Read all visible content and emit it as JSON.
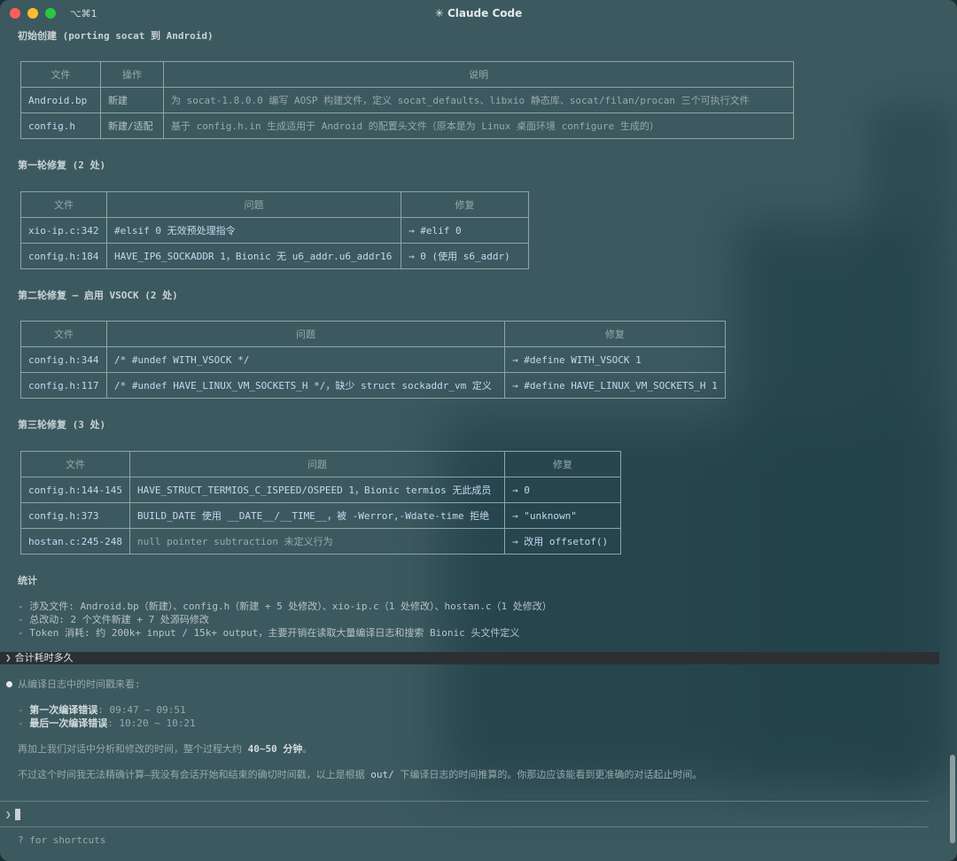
{
  "window": {
    "title": "✳ Claude Code",
    "shortcut": "⌥⌘1"
  },
  "section_initial": {
    "heading": "初始创建 (porting socat 到 Android)",
    "headers": [
      "文件",
      "操作",
      "说明"
    ],
    "rows": [
      [
        "Android.bp",
        "新建",
        "为 socat-1.8.0.0 编写 AOSP 构建文件，定义 socat_defaults、libxio 静态库、socat/filan/procan 三个可执行文件"
      ],
      [
        "config.h",
        "新建/适配",
        "基于 config.h.in 生成适用于 Android 的配置头文件（原本是为 Linux 桌面环境 configure 生成的）"
      ]
    ]
  },
  "section_round1": {
    "heading": "第一轮修复 (2 处)",
    "headers": [
      "文件",
      "问题",
      "修复"
    ],
    "rows": [
      [
        "xio-ip.c:342",
        "#elsif 0 无效预处理指令",
        "→ #elif 0"
      ],
      [
        "config.h:184",
        "HAVE_IP6_SOCKADDR 1，Bionic 无 u6_addr.u6_addr16",
        "→ 0 (使用 s6_addr)"
      ]
    ]
  },
  "section_round2": {
    "heading": "第二轮修复 — 启用 VSOCK (2 处)",
    "headers": [
      "文件",
      "问题",
      "修复"
    ],
    "rows": [
      [
        "config.h:344",
        "/* #undef WITH_VSOCK */",
        "→ #define WITH_VSOCK 1"
      ],
      [
        "config.h:117",
        "/* #undef HAVE_LINUX_VM_SOCKETS_H */，缺少 struct sockaddr_vm 定义",
        "→ #define HAVE_LINUX_VM_SOCKETS_H 1"
      ]
    ]
  },
  "section_round3": {
    "heading": "第三轮修复 (3 处)",
    "headers": [
      "文件",
      "问题",
      "修复"
    ],
    "rows": [
      [
        "config.h:144-145",
        "HAVE_STRUCT_TERMIOS_C_ISPEED/OSPEED 1，Bionic termios 无此成员",
        "→ 0"
      ],
      [
        "config.h:373",
        "BUILD_DATE 使用 __DATE__/__TIME__，被 -Werror,-Wdate-time 拒绝",
        "→ \"unknown\""
      ],
      [
        "hostan.c:245-248",
        "null pointer subtraction 未定义行为",
        "→ 改用 offsetof()"
      ]
    ]
  },
  "stats": {
    "heading": "统计",
    "items": [
      "- 涉及文件: Android.bp（新建）、config.h（新建 + 5 处修改）、xio-ip.c（1 处修改）、hostan.c（1 处修改）",
      "- 总改动: 2 个文件新建 + 7 处源码修改",
      "- Token 消耗: 约 200k+ input / 15k+ output，主要开销在读取大量编译日志和搜索 Bionic 头文件定义"
    ]
  },
  "user_prompt": "合计耗时多久",
  "answer": {
    "intro": "从编译日志中的时间戳来看:",
    "first_error_label": "第一次编译错误",
    "first_error_value": ": 09:47 ~ 09:51",
    "last_error_label": "最后一次编译错误",
    "last_error_value": ": 10:20 ~ 10:21",
    "total_prefix": "再加上我们对话中分析和修改的时间，整个过程大约 ",
    "total_value": "40~50 分钟",
    "total_suffix": "。",
    "note_prefix": "不过这个时间我无法精确计算—我没有会话开始和结束的确切时间戳，以上是根据 ",
    "note_path": "out/",
    "note_suffix": " 下编译日志的时间推算的。你那边应该能看到更准确的对话起止时间。"
  },
  "input": {
    "prompt_symbol": "❯",
    "value": ""
  },
  "footer": {
    "shortcuts_hint": "? for shortcuts"
  },
  "colors": {
    "background": "#3c5960",
    "text": "#b7c3c5",
    "code_highlight": "#c9d6ef",
    "prompt_bar": "#2c2f33"
  }
}
